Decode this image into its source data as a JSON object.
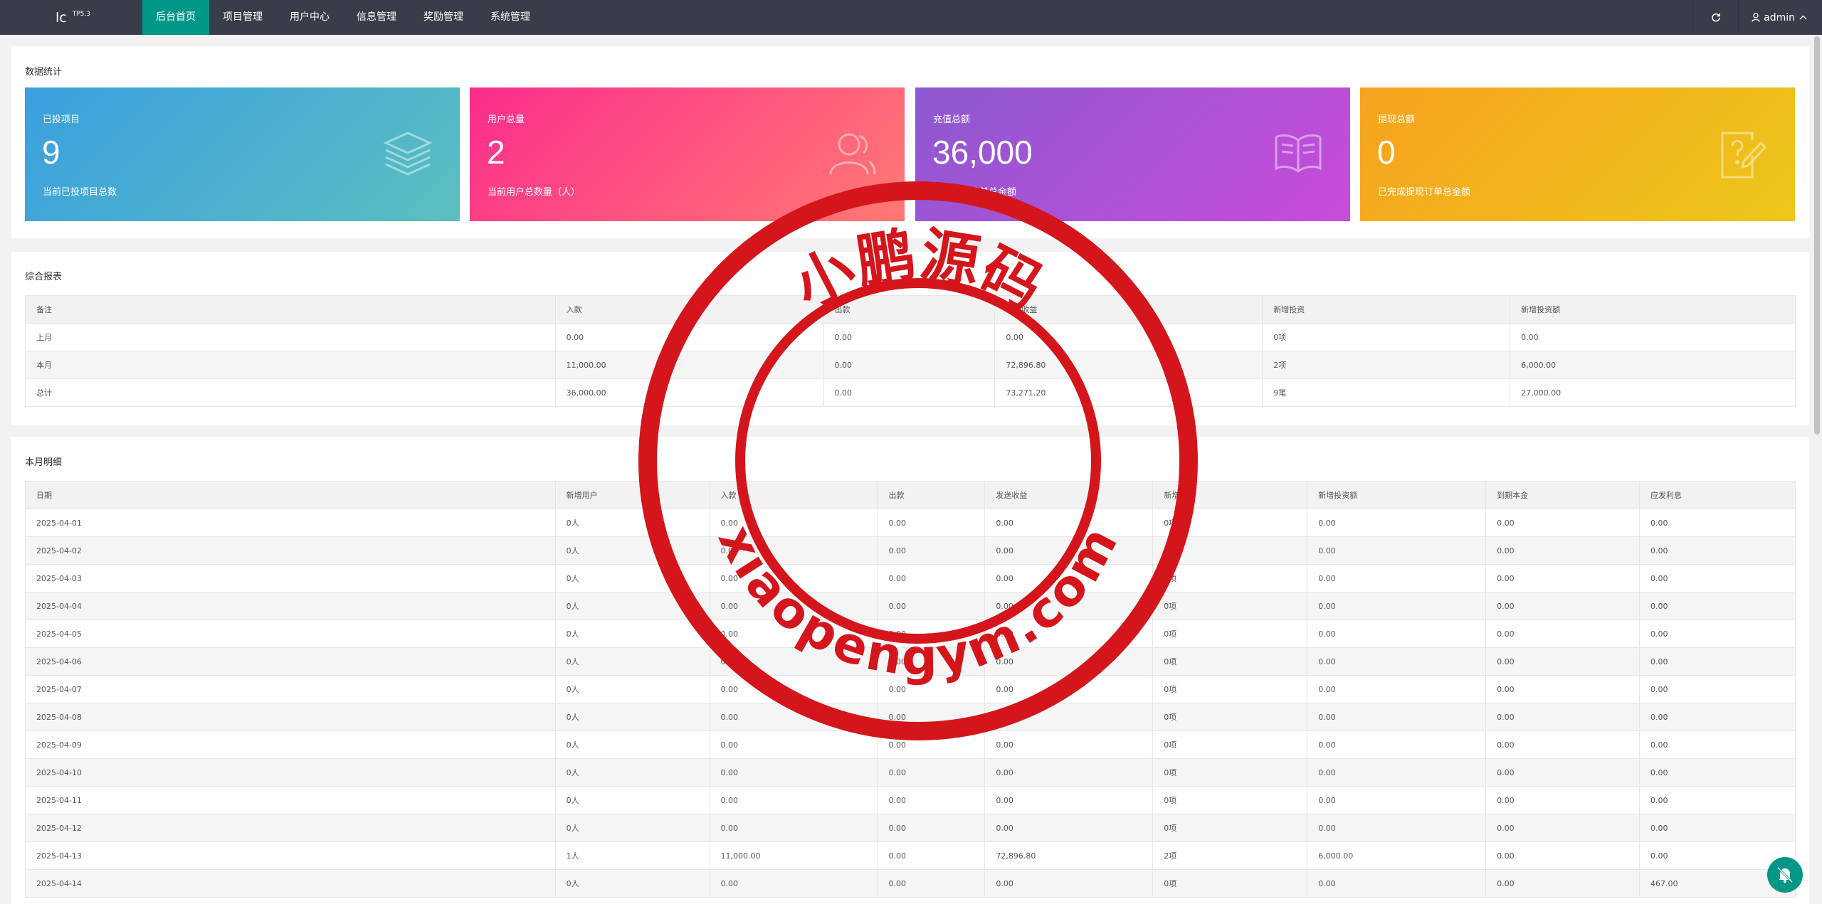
{
  "header": {
    "logo": "lc",
    "logo_version": "TP5.3",
    "nav": [
      "后台首页",
      "项目管理",
      "用户中心",
      "信息管理",
      "奖励管理",
      "系统管理"
    ],
    "active_nav": "后台首页",
    "user": "admin",
    "refresh_icon": "refresh-icon"
  },
  "stats": {
    "title": "数据统计",
    "tiles": [
      {
        "label": "已投项目",
        "value": "9",
        "desc": "当前已投项目总数",
        "icon": "layers-icon",
        "gradient": [
          "#3a9fdf",
          "#5bbfc0"
        ]
      },
      {
        "label": "用户总量",
        "value": "2",
        "desc": "当前用户总数量（人）",
        "icon": "users-icon",
        "gradient": [
          "#fb2d8c",
          "#ff7a73"
        ]
      },
      {
        "label": "充值总额",
        "value": "36,000",
        "desc": "已完成充值单总金额",
        "icon": "book-icon",
        "gradient": [
          "#8c59d1",
          "#c94bdb"
        ]
      },
      {
        "label": "提现总额",
        "value": "0",
        "desc": "已完成提现订单总金额",
        "icon": "edit-help-icon",
        "gradient": [
          "#f7a21f",
          "#ebc71a"
        ]
      }
    ]
  },
  "report": {
    "title": "综合报表",
    "headers": [
      "备注",
      "入款",
      "出款",
      "发送收益",
      "新增投资",
      "新增投资额"
    ],
    "rows": [
      [
        "上月",
        "0.00",
        "0.00",
        "0.00",
        "0项",
        "0.00"
      ],
      [
        "本月",
        "11,000.00",
        "0.00",
        "72,896.80",
        "2项",
        "6,000.00"
      ],
      [
        "总计",
        "36,000.00",
        "0.00",
        "73,271.20",
        "9笔",
        "27,000.00"
      ]
    ]
  },
  "detail": {
    "title": "本月明细",
    "headers": [
      "日期",
      "新增用户",
      "入款",
      "出款",
      "发送收益",
      "新增投资",
      "新增投资额",
      "到期本金",
      "应发利息"
    ],
    "rows": [
      [
        "2025-04-01",
        "0人",
        "0.00",
        "0.00",
        "0.00",
        "0项",
        "0.00",
        "0.00",
        "0.00"
      ],
      [
        "2025-04-02",
        "0人",
        "0.00",
        "0.00",
        "0.00",
        "0项",
        "0.00",
        "0.00",
        "0.00"
      ],
      [
        "2025-04-03",
        "0人",
        "0.00",
        "0.00",
        "0.00",
        "0项",
        "0.00",
        "0.00",
        "0.00"
      ],
      [
        "2025-04-04",
        "0人",
        "0.00",
        "0.00",
        "0.00",
        "0项",
        "0.00",
        "0.00",
        "0.00"
      ],
      [
        "2025-04-05",
        "0人",
        "0.00",
        "0.00",
        "0.00",
        "0项",
        "0.00",
        "0.00",
        "0.00"
      ],
      [
        "2025-04-06",
        "0人",
        "0.00",
        "0.00",
        "0.00",
        "0项",
        "0.00",
        "0.00",
        "0.00"
      ],
      [
        "2025-04-07",
        "0人",
        "0.00",
        "0.00",
        "0.00",
        "0项",
        "0.00",
        "0.00",
        "0.00"
      ],
      [
        "2025-04-08",
        "0人",
        "0.00",
        "0.00",
        "0.00",
        "0项",
        "0.00",
        "0.00",
        "0.00"
      ],
      [
        "2025-04-09",
        "0人",
        "0.00",
        "0.00",
        "0.00",
        "0项",
        "0.00",
        "0.00",
        "0.00"
      ],
      [
        "2025-04-10",
        "0人",
        "0.00",
        "0.00",
        "0.00",
        "0项",
        "0.00",
        "0.00",
        "0.00"
      ],
      [
        "2025-04-11",
        "0人",
        "0.00",
        "0.00",
        "0.00",
        "0项",
        "0.00",
        "0.00",
        "0.00"
      ],
      [
        "2025-04-12",
        "0人",
        "0.00",
        "0.00",
        "0.00",
        "0项",
        "0.00",
        "0.00",
        "0.00"
      ],
      [
        "2025-04-13",
        "1人",
        "11,000.00",
        "0.00",
        "72,896.80",
        "2项",
        "6,000.00",
        "0.00",
        "0.00"
      ],
      [
        "2025-04-14",
        "0人",
        "0.00",
        "0.00",
        "0.00",
        "0项",
        "0.00",
        "0.00",
        "467.00"
      ]
    ]
  },
  "watermark": {
    "top_text": "小鹏源码",
    "bottom_text": "xiaopengym.com",
    "color": "#d4161c"
  }
}
